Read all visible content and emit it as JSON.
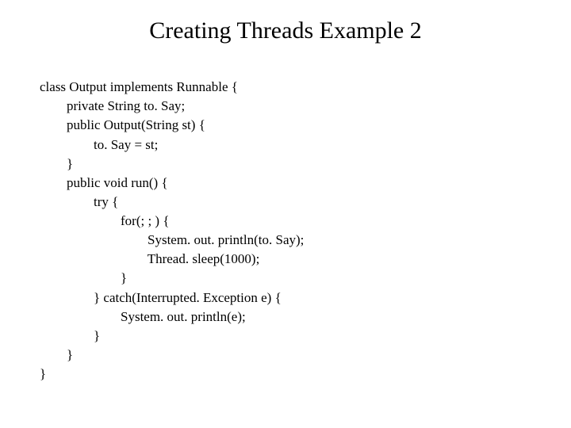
{
  "title": "Creating Threads Example 2",
  "code": {
    "l0": "class Output implements Runnable {",
    "l1": "        private String to. Say;",
    "l2": "        public Output(String st) {",
    "l3": "                to. Say = st;",
    "l4": "        }",
    "l5": "        public void run() {",
    "l6": "                try {",
    "l7": "                        for(; ; ) {",
    "l8": "                                System. out. println(to. Say);",
    "l9": "                                Thread. sleep(1000);",
    "l10": "                        }",
    "l11": "                } catch(Interrupted. Exception e) {",
    "l12": "                        System. out. println(e);",
    "l13": "                }",
    "l14": "        }",
    "l15": "}"
  }
}
